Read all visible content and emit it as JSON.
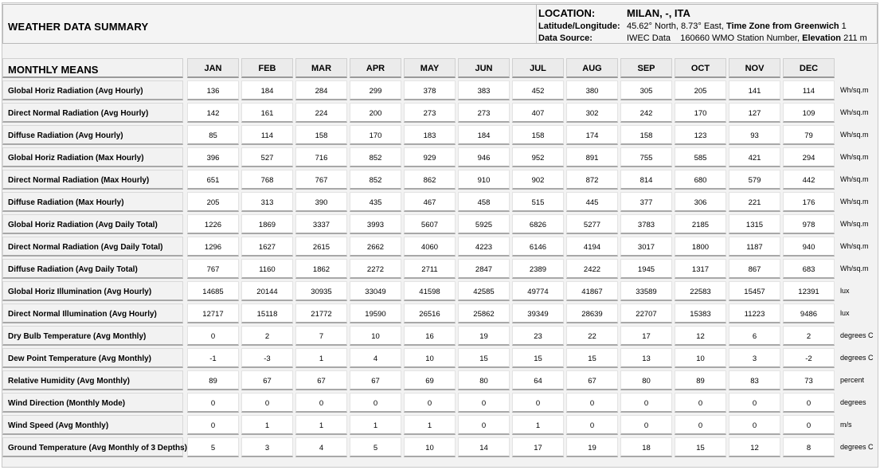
{
  "header": {
    "title": "WEATHER DATA SUMMARY",
    "location_label": "LOCATION:",
    "location_value": "MILAN, -, ITA",
    "latlong_label": "Latitude/Longitude:",
    "latlong_value": "45.62° North, 8.73° East,",
    "timezone_label": "Time Zone from Greenwich",
    "timezone_value": "1",
    "source_label": "Data Source:",
    "source_value": "IWEC Data",
    "station_value": "160660 WMO Station Number,",
    "elevation_label": "Elevation",
    "elevation_value": "211 m"
  },
  "table": {
    "heading": "MONTHLY MEANS",
    "months": [
      "JAN",
      "FEB",
      "MAR",
      "APR",
      "MAY",
      "JUN",
      "JUL",
      "AUG",
      "SEP",
      "OCT",
      "NOV",
      "DEC"
    ],
    "rows": [
      {
        "label": "Global Horiz Radiation (Avg Hourly)",
        "values": [
          "136",
          "184",
          "284",
          "299",
          "378",
          "383",
          "452",
          "380",
          "305",
          "205",
          "141",
          "114"
        ],
        "unit": "Wh/sq.m"
      },
      {
        "label": "Direct Normal Radiation (Avg Hourly)",
        "values": [
          "142",
          "161",
          "224",
          "200",
          "273",
          "273",
          "407",
          "302",
          "242",
          "170",
          "127",
          "109"
        ],
        "unit": "Wh/sq.m"
      },
      {
        "label": "Diffuse Radiation (Avg Hourly)",
        "values": [
          "85",
          "114",
          "158",
          "170",
          "183",
          "184",
          "158",
          "174",
          "158",
          "123",
          "93",
          "79"
        ],
        "unit": "Wh/sq.m"
      },
      {
        "label": "Global Horiz Radiation (Max Hourly)",
        "values": [
          "396",
          "527",
          "716",
          "852",
          "929",
          "946",
          "952",
          "891",
          "755",
          "585",
          "421",
          "294"
        ],
        "unit": "Wh/sq.m"
      },
      {
        "label": "Direct Normal Radiation (Max Hourly)",
        "values": [
          "651",
          "768",
          "767",
          "852",
          "862",
          "910",
          "902",
          "872",
          "814",
          "680",
          "579",
          "442"
        ],
        "unit": "Wh/sq.m"
      },
      {
        "label": "Diffuse Radiation (Max Hourly)",
        "values": [
          "205",
          "313",
          "390",
          "435",
          "467",
          "458",
          "515",
          "445",
          "377",
          "306",
          "221",
          "176"
        ],
        "unit": "Wh/sq.m"
      },
      {
        "label": "Global Horiz Radiation (Avg Daily Total)",
        "values": [
          "1226",
          "1869",
          "3337",
          "3993",
          "5607",
          "5925",
          "6826",
          "5277",
          "3783",
          "2185",
          "1315",
          "978"
        ],
        "unit": "Wh/sq.m"
      },
      {
        "label": "Direct Normal Radiation (Avg Daily Total)",
        "values": [
          "1296",
          "1627",
          "2615",
          "2662",
          "4060",
          "4223",
          "6146",
          "4194",
          "3017",
          "1800",
          "1187",
          "940"
        ],
        "unit": "Wh/sq.m"
      },
      {
        "label": "Diffuse Radiation (Avg Daily Total)",
        "values": [
          "767",
          "1160",
          "1862",
          "2272",
          "2711",
          "2847",
          "2389",
          "2422",
          "1945",
          "1317",
          "867",
          "683"
        ],
        "unit": "Wh/sq.m"
      },
      {
        "label": "Global Horiz Illumination (Avg Hourly)",
        "values": [
          "14685",
          "20144",
          "30935",
          "33049",
          "41598",
          "42585",
          "49774",
          "41867",
          "33589",
          "22583",
          "15457",
          "12391"
        ],
        "unit": "lux"
      },
      {
        "label": "Direct Normal Illumination (Avg Hourly)",
        "values": [
          "12717",
          "15118",
          "21772",
          "19590",
          "26516",
          "25862",
          "39349",
          "28639",
          "22707",
          "15383",
          "11223",
          "9486"
        ],
        "unit": "lux"
      },
      {
        "label": "Dry Bulb Temperature (Avg Monthly)",
        "values": [
          "0",
          "2",
          "7",
          "10",
          "16",
          "19",
          "23",
          "22",
          "17",
          "12",
          "6",
          "2"
        ],
        "unit": "degrees C"
      },
      {
        "label": "Dew Point Temperature (Avg Monthly)",
        "values": [
          "-1",
          "-3",
          "1",
          "4",
          "10",
          "15",
          "15",
          "15",
          "13",
          "10",
          "3",
          "-2"
        ],
        "unit": "degrees C"
      },
      {
        "label": "Relative Humidity (Avg Monthly)",
        "values": [
          "89",
          "67",
          "67",
          "67",
          "69",
          "80",
          "64",
          "67",
          "80",
          "89",
          "83",
          "73"
        ],
        "unit": "percent"
      },
      {
        "label": "Wind Direction (Monthly Mode)",
        "values": [
          "0",
          "0",
          "0",
          "0",
          "0",
          "0",
          "0",
          "0",
          "0",
          "0",
          "0",
          "0"
        ],
        "unit": "degrees"
      },
      {
        "label": "Wind Speed (Avg Monthly)",
        "values": [
          "0",
          "1",
          "1",
          "1",
          "1",
          "0",
          "1",
          "0",
          "0",
          "0",
          "0",
          "0"
        ],
        "unit": "m/s"
      },
      {
        "label": "Ground Temperature (Avg Monthly of 3 Depths)",
        "values": [
          "5",
          "3",
          "4",
          "5",
          "10",
          "14",
          "17",
          "19",
          "18",
          "15",
          "12",
          "8"
        ],
        "unit": "degrees C"
      }
    ]
  }
}
